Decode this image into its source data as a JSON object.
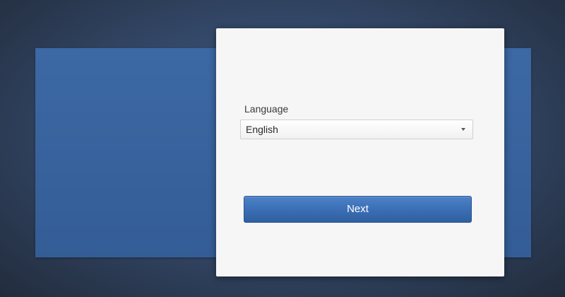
{
  "setup": {
    "language_label": "Language",
    "language_value": "English",
    "next_label": "Next"
  },
  "colors": {
    "accent": "#3a6db3",
    "background": "#34496a",
    "dialog": "#f6f6f6"
  },
  "icons": {
    "dropdown": "chevron-down-icon"
  }
}
